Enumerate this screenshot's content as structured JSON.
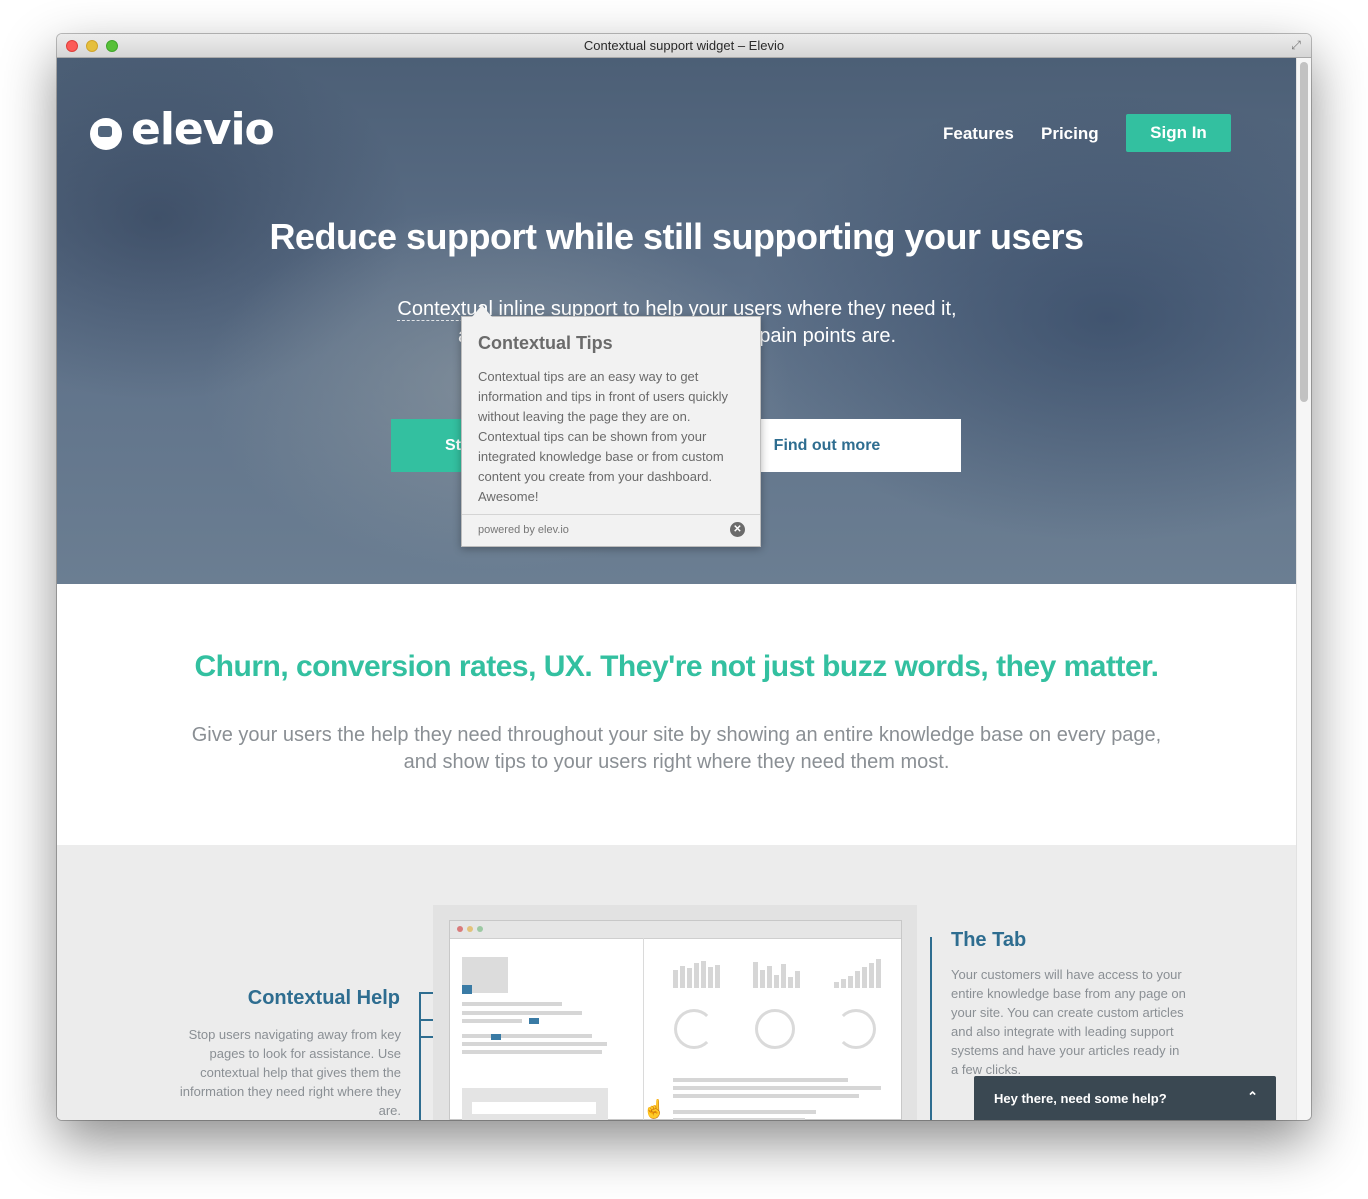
{
  "window": {
    "title": "Contextual support widget – Elevio"
  },
  "brand": {
    "logo_text": "elevio",
    "accent": "#33c0a0",
    "blue": "#2e6d90"
  },
  "nav": {
    "features": "Features",
    "pricing": "Pricing",
    "sign_in": "Sign In"
  },
  "hero": {
    "title": "Reduce support while still supporting your users",
    "subtitle_trigger": "Contextual",
    "subtitle_rest": " inline support to help your users where they need it, and also identify where your sites pain points are.",
    "primary_button": "Start your free trial",
    "secondary_button": "Find out more"
  },
  "popover": {
    "title": "Contextual Tips",
    "body": "Contextual tips are an easy way to get information and tips in front of users quickly without leaving the page they are on. Contextual tips can be shown from your integrated knowledge base or from custom content you create from your dashboard. Awesome!",
    "powered": "powered by elev.io",
    "close_icon": "close-icon"
  },
  "section2": {
    "title": "Churn, conversion rates, UX. They're not just buzz words, they matter.",
    "subtitle": "Give your users the help they need throughout your site by showing an entire knowledge base on every page, and show tips to your users right where they need them most."
  },
  "features": {
    "contextual_help": {
      "title": "Contextual Help",
      "description": "Stop users navigating away from key pages to look for assistance. Use contextual help that gives them the information they need right where they are."
    },
    "the_tab": {
      "title": "The Tab",
      "description": "Your customers will have access to your entire knowledge base from any page on your site. You can create custom articles and also integrate with leading support systems and have your articles ready in a few clicks."
    }
  },
  "chat": {
    "label": "Hey there, need some help?",
    "icon": "chevron-up-icon"
  }
}
